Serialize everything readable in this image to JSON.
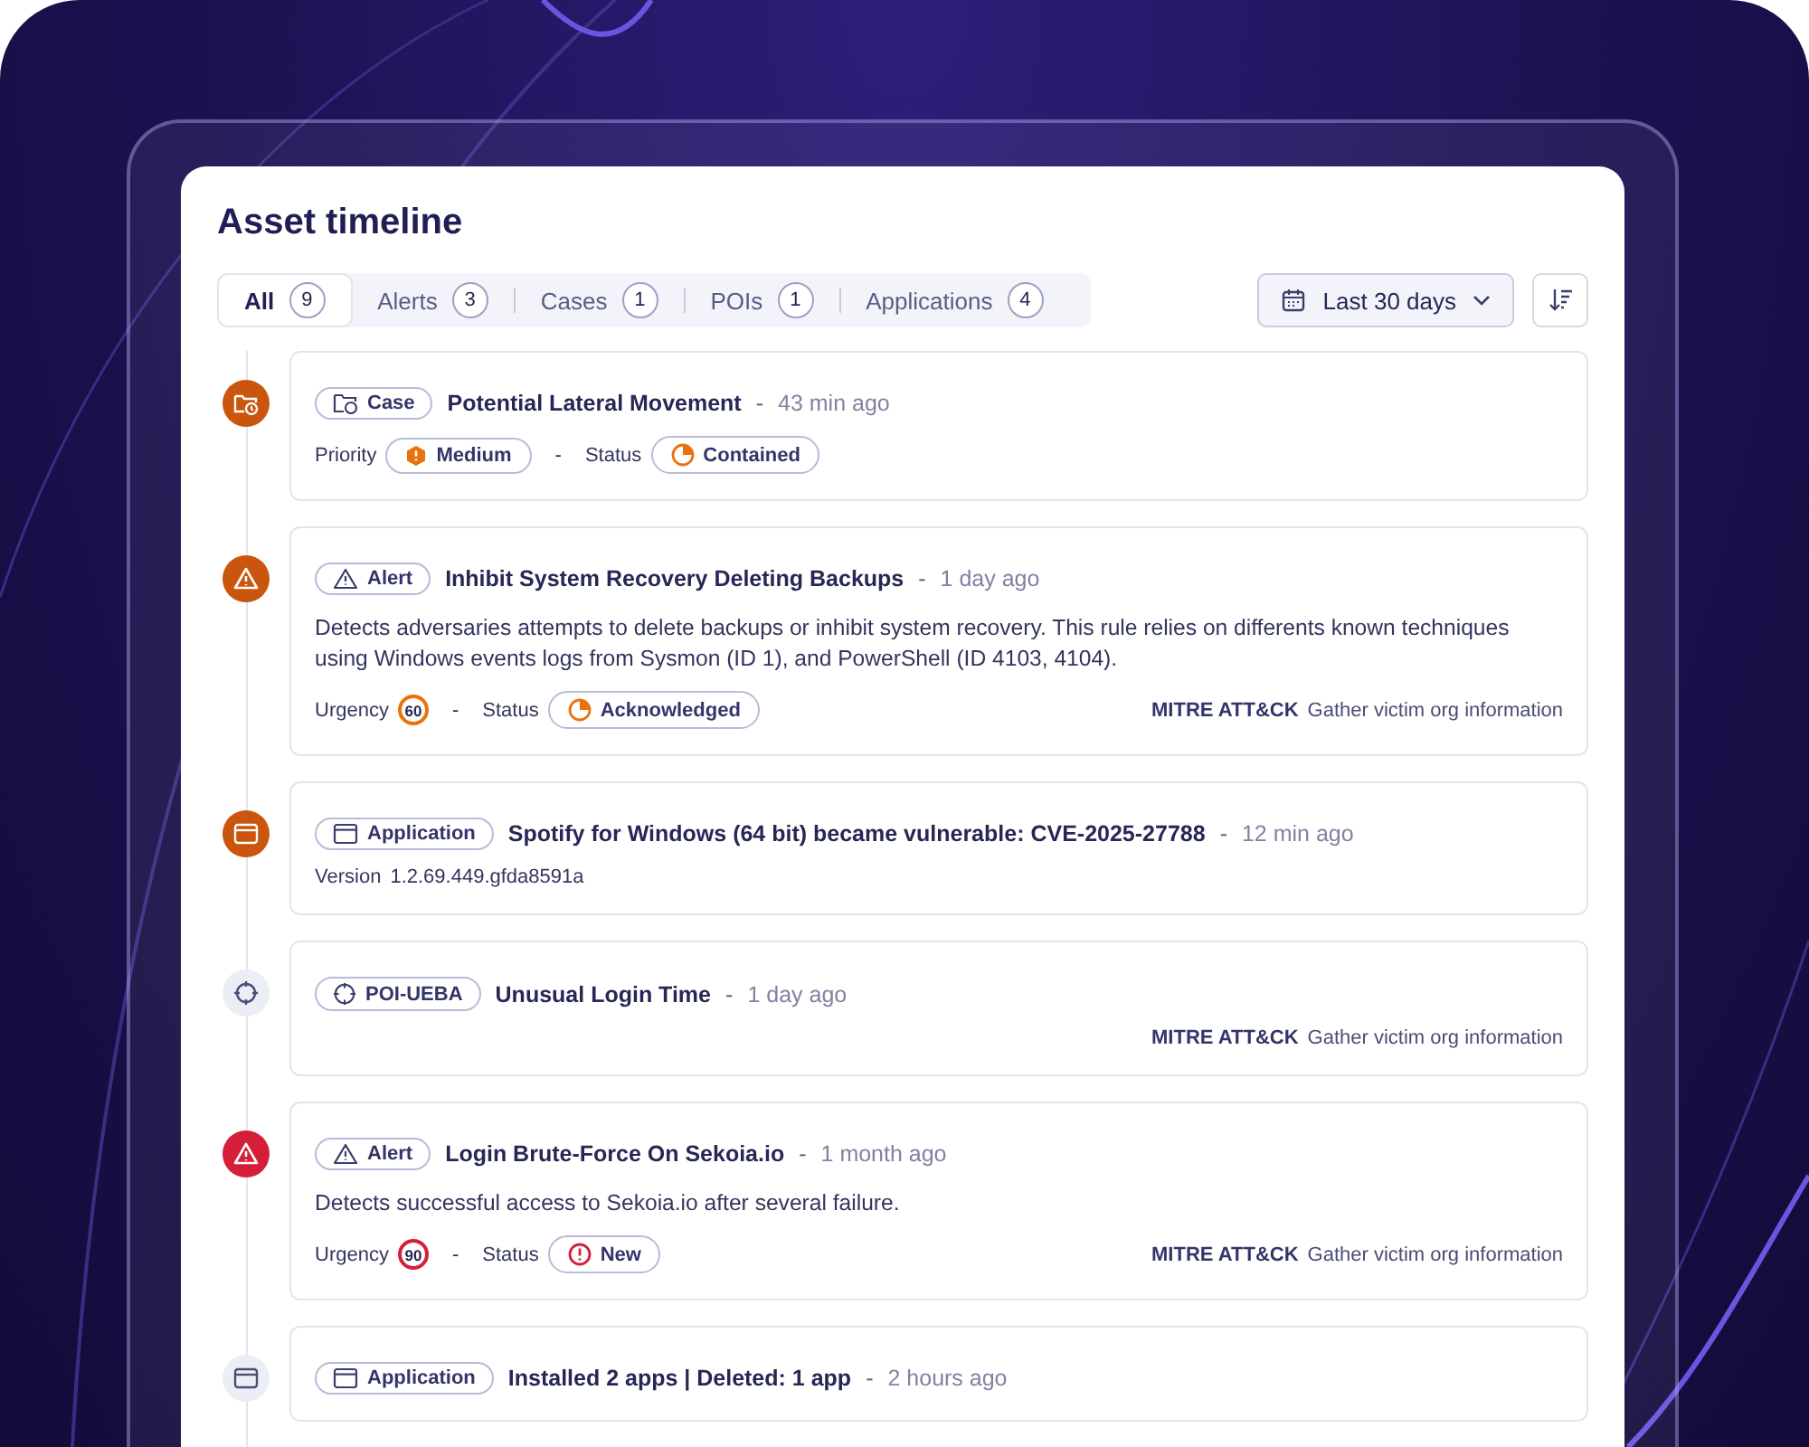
{
  "title": "Asset timeline",
  "tabs": [
    {
      "label": "All",
      "count": "9",
      "selected": true
    },
    {
      "label": "Alerts",
      "count": "3",
      "selected": false
    },
    {
      "label": "Cases",
      "count": "1",
      "selected": false
    },
    {
      "label": "POIs",
      "count": "1",
      "selected": false
    },
    {
      "label": "Applications",
      "count": "4",
      "selected": false
    }
  ],
  "date_range": "Last 30 days",
  "entries": [
    {
      "kind": "case",
      "color": "#c9560c",
      "tag": "Case",
      "title": "Potential Lateral Movement",
      "sep": "-",
      "time": "43 min ago",
      "fields": [
        {
          "kind": "priority",
          "label": "Priority",
          "value": "Medium",
          "color": "#e8730c"
        },
        {
          "kind": "progress_status",
          "label": "Status",
          "value": "Contained",
          "color": "#e8730c"
        }
      ],
      "field_sep": "-"
    },
    {
      "kind": "alert",
      "color": "#c9560c",
      "tag": "Alert",
      "title": "Inhibit System Recovery Deleting Backups",
      "sep": "-",
      "time": "1 day ago",
      "description": "Detects adversaries attempts to delete backups or inhibit system recovery. This rule relies on differents known techniques using Windows events logs from Sysmon (ID 1), and PowerShell (ID 4103, 4104).",
      "fields": [
        {
          "kind": "urgency",
          "label": "Urgency",
          "value": "60",
          "color": "#e8730c"
        },
        {
          "kind": "progress_status",
          "label": "Status",
          "value": "Acknowledged",
          "color": "#e8730c"
        }
      ],
      "field_sep": "-",
      "mitre": {
        "label": "MITRE ATT&CK",
        "value": "Gather victim org information"
      }
    },
    {
      "kind": "application",
      "color": "#c9560c",
      "tag": "Application",
      "title": "Spotify for Windows (64 bit) became vulnerable: CVE-2025-27788",
      "sep": "-",
      "time": "12 min ago",
      "fields": [
        {
          "kind": "version",
          "label": "Version",
          "value": "1.2.69.449.gfda8591a"
        }
      ]
    },
    {
      "kind": "poi",
      "color": "#eceef6",
      "tag": "POI-UEBA",
      "title": "Unusual Login Time",
      "sep": "-",
      "time": "1 day ago",
      "mitre": {
        "label": "MITRE ATT&CK",
        "value": "Gather victim org information"
      }
    },
    {
      "kind": "alert",
      "color": "#d51f38",
      "tag": "Alert",
      "title": "Login Brute-Force On Sekoia.io",
      "sep": "-",
      "time": "1 month ago",
      "description": "Detects successful access to Sekoia.io after several failure.",
      "fields": [
        {
          "kind": "urgency",
          "label": "Urgency",
          "value": "90",
          "color": "#d51f38"
        },
        {
          "kind": "new_status",
          "label": "Status",
          "value": "New",
          "color": "#d51f38"
        }
      ],
      "field_sep": "-",
      "mitre": {
        "label": "MITRE ATT&CK",
        "value": "Gather victim org information"
      }
    },
    {
      "kind": "application",
      "color": "#eceef6",
      "tag": "Application",
      "title": "Installed 2 apps | Deleted: 1 app",
      "sep": "-",
      "time": "2 hours ago"
    }
  ]
}
